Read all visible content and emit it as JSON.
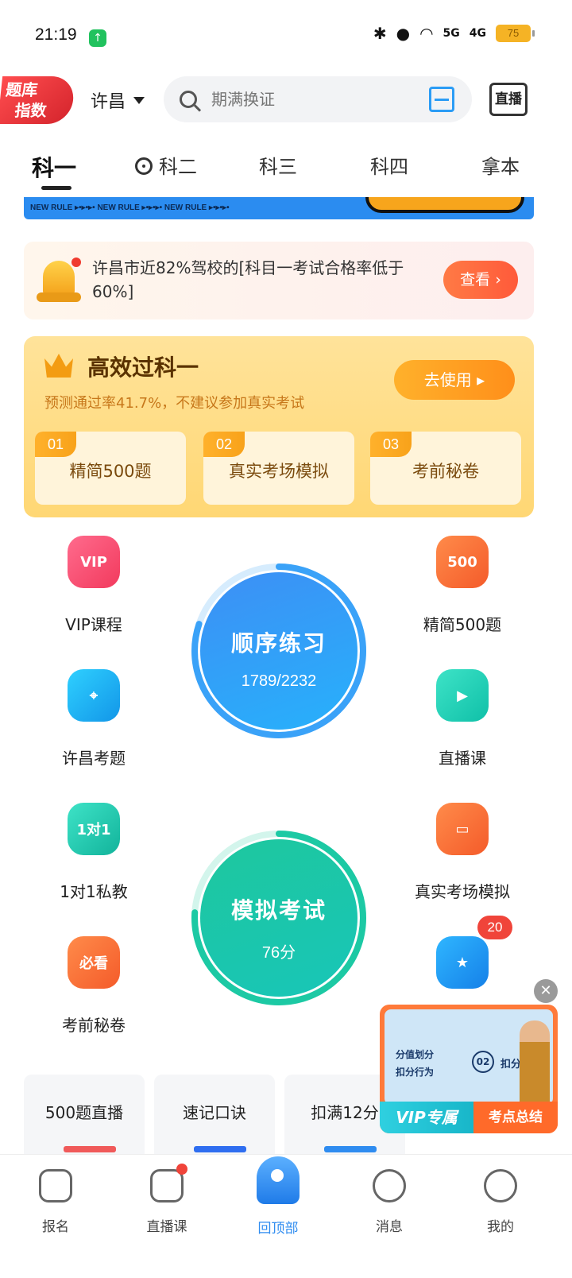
{
  "status_bar": {
    "time": "21:19",
    "battery": "75",
    "network_5g": "5G",
    "network_4g": "4G"
  },
  "header": {
    "logo_line1": "题库",
    "logo_line2": "指数",
    "city": "许昌",
    "search_placeholder": "期满换证",
    "live_label": "直播"
  },
  "tabs": [
    "科一",
    "科二",
    "科三",
    "科四",
    "拿本"
  ],
  "banner": {
    "text": "NEW RULE ▸•▸•▸• NEW RULE ▸•▸•▸• NEW RULE ▸•▸•▸•"
  },
  "notice": {
    "text": "许昌市近82%驾校的[科目一考试合格率低于60%]",
    "button": "查看"
  },
  "promo": {
    "title": "高效过科一",
    "subtitle": "预测通过率41.7%，不建议参加真实考试",
    "button": "去使用 ▸",
    "items": [
      {
        "num": "01",
        "label": "精简500题"
      },
      {
        "num": "02",
        "label": "真实考场模拟"
      },
      {
        "num": "03",
        "label": "考前秘卷"
      }
    ]
  },
  "features": {
    "vip": {
      "label": "VIP课程",
      "icon_text": "VIP"
    },
    "jingjian": {
      "label": "精简500题",
      "icon_text": "500"
    },
    "local": {
      "label": "许昌考题"
    },
    "live": {
      "label": "直播课"
    },
    "tutor": {
      "label": "1对1私教",
      "icon_text": "1对1"
    },
    "real": {
      "label": "真实考场模拟"
    },
    "exam_secret": {
      "label": "考前秘卷",
      "icon_text": "必看"
    },
    "favorite": {
      "badge": "20"
    }
  },
  "practice": {
    "title": "顺序练习",
    "progress_text": "1789/2232",
    "done": 1789,
    "total": 2232
  },
  "mock": {
    "title": "模拟考试",
    "score_text": "76分",
    "score": 76
  },
  "bottom_cards": [
    "500题直播",
    "速记口诀",
    "扣满12分"
  ],
  "float_video": {
    "row1": "分值划分",
    "row2": "扣分行为",
    "num": "02",
    "deduct": "扣分分值",
    "vip": "VIP专属",
    "summary": "考点总结"
  },
  "bottom_nav": [
    {
      "label": "报名"
    },
    {
      "label": "直播课"
    },
    {
      "label": "回顶部"
    },
    {
      "label": "消息"
    },
    {
      "label": "我的"
    }
  ],
  "colors": {
    "accent_blue": "#2f8cf0",
    "accent_green": "#16c59c",
    "accent_orange": "#ff8f1a"
  }
}
